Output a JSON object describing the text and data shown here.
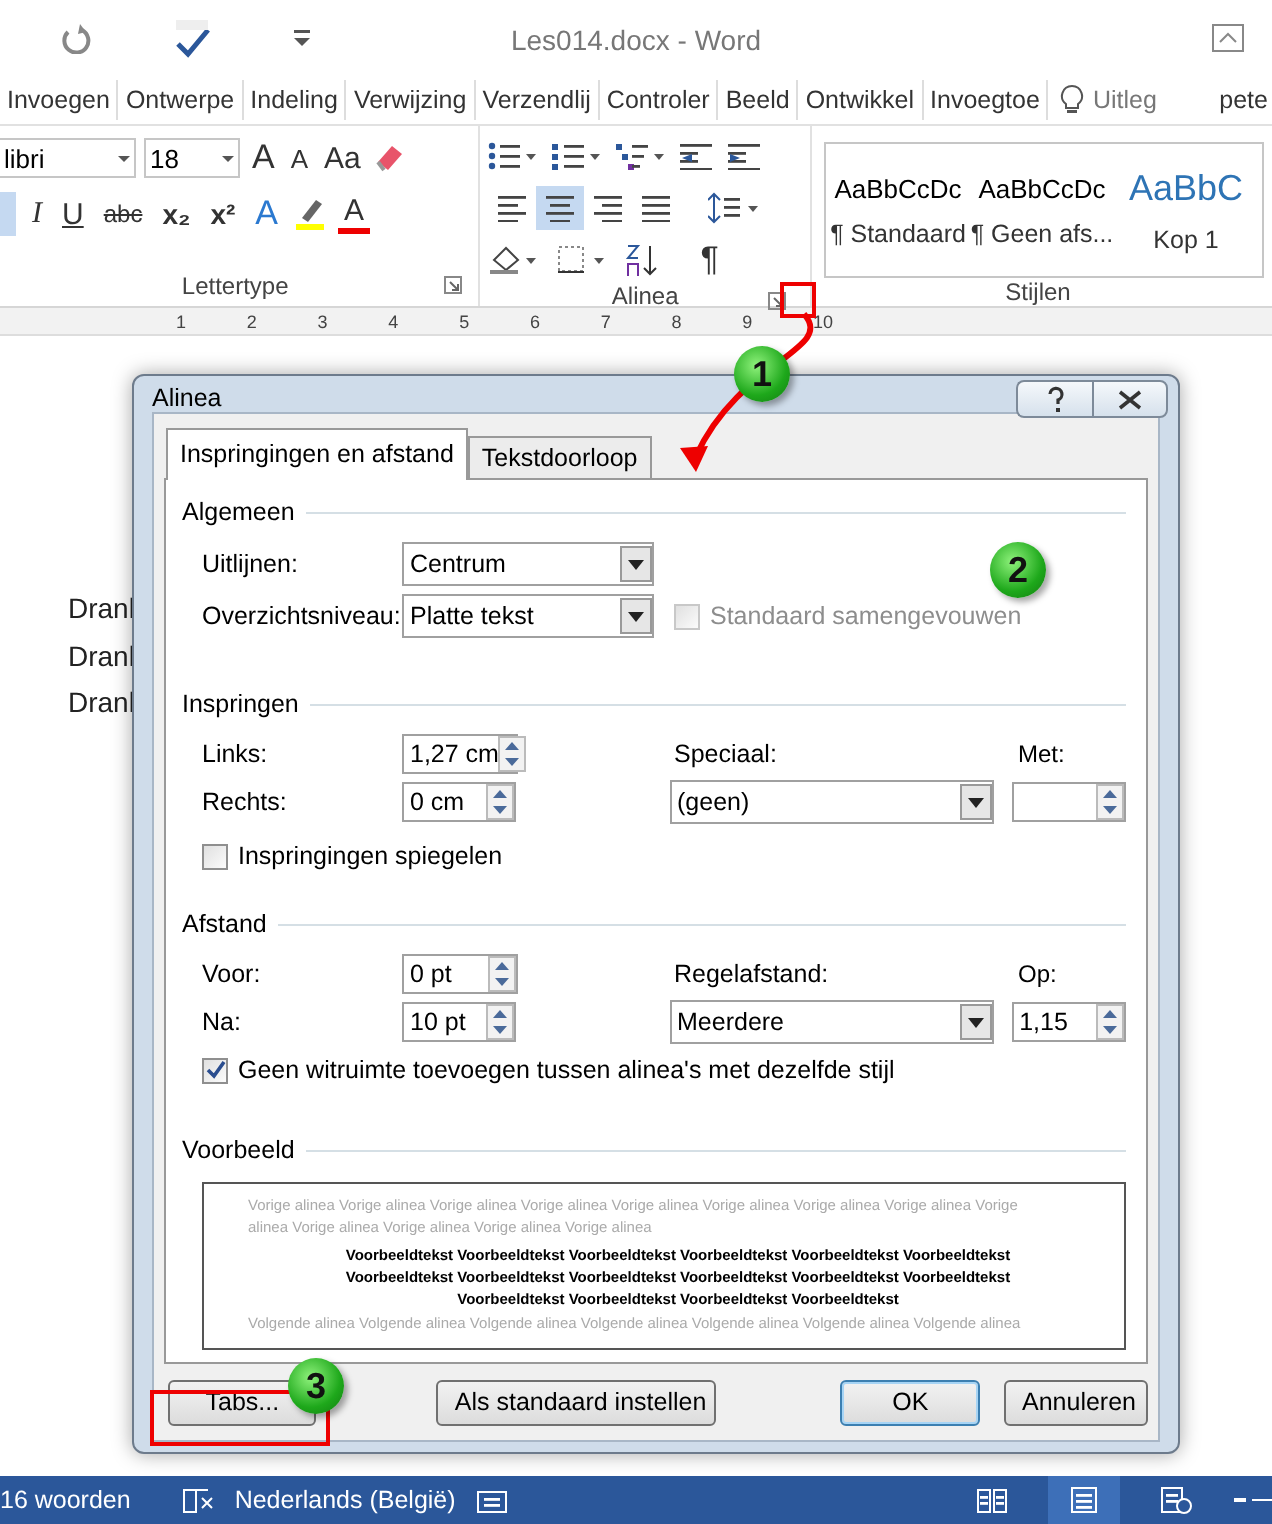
{
  "title_bar": {
    "title": "Les014.docx - Word"
  },
  "ribbon_tabs": [
    {
      "label": "Invoegen",
      "selected": false
    },
    {
      "label": "Ontwerpe",
      "selected": false
    },
    {
      "label": "Indeling",
      "selected": false
    },
    {
      "label": "Verwijzing",
      "selected": false
    },
    {
      "label": "Verzendlij",
      "selected": false
    },
    {
      "label": "Controler",
      "selected": false
    },
    {
      "label": "Beeld",
      "selected": false
    },
    {
      "label": "Ontwikkel",
      "selected": false
    },
    {
      "label": "Invoegtoe",
      "selected": false
    }
  ],
  "tell_me": "Uitleg",
  "user": "pete",
  "font_group": {
    "label": "Lettertype",
    "font": "libri",
    "size": "18",
    "grow": "A",
    "shrink": "A",
    "case": "Aa",
    "format_buttons": [
      "I",
      "U",
      "abc",
      "x₂",
      "x²"
    ],
    "effects": "A",
    "font_color_glyph": "A"
  },
  "paragraph_group": {
    "label": "Alinea",
    "align_buttons": [
      {
        "kind": "left",
        "selected": false
      },
      {
        "kind": "center",
        "selected": true
      },
      {
        "kind": "right",
        "selected": false
      },
      {
        "kind": "justify",
        "selected": false
      }
    ],
    "pilcrow": "¶"
  },
  "styles_group": {
    "label": "Stijlen",
    "items": [
      {
        "sample": "AaBbCcDc",
        "name": "¶ Standaard",
        "kind": "normal"
      },
      {
        "sample": "AaBbCcDc",
        "name": "¶ Geen afs...",
        "kind": "normal"
      },
      {
        "sample": "AaBbC",
        "name": "Kop 1",
        "kind": "heading"
      }
    ]
  },
  "ruler": [
    "1",
    "2",
    "3",
    "4",
    "5",
    "6",
    "7",
    "8",
    "9",
    "10"
  ],
  "document_lines": [
    "Dranl",
    "Dranl",
    "Dranl"
  ],
  "dialog": {
    "title": "Alinea",
    "tabs": [
      {
        "label": "Inspringingen en afstand",
        "selected": true
      },
      {
        "label": "Tekstdoorloop",
        "selected": false
      }
    ],
    "general": {
      "heading": "Algemeen",
      "alignment": {
        "label": "Uitlijnen:",
        "value": "Centrum"
      },
      "outline_level": {
        "label": "Overzichtsniveau:",
        "value": "Platte tekst"
      },
      "collapsed": {
        "label": "Standaard samengevouwen",
        "checked": false,
        "disabled": true
      }
    },
    "indentation": {
      "heading": "Inspringen",
      "left": {
        "label": "Links:",
        "value": "1,27 cm"
      },
      "right": {
        "label": "Rechts:",
        "value": "0 cm"
      },
      "special": {
        "label": "Speciaal:",
        "value": "(geen)"
      },
      "by": {
        "label": "Met:"
      },
      "mirror": {
        "label": "Inspringingen spiegelen",
        "checked": false,
        "disabled": false
      }
    },
    "spacing": {
      "heading": "Afstand",
      "before": {
        "label": "Voor:",
        "value": "0 pt"
      },
      "after": {
        "label": "Na:",
        "value": "10 pt"
      },
      "line_spacing": {
        "label": "Regelafstand:",
        "value": "Meerdere"
      },
      "at": {
        "label": "Op:",
        "value": "1,15"
      },
      "no_space": {
        "label": "Geen witruimte toevoegen tussen alinea's met dezelfde stijl",
        "checked": true,
        "disabled": false
      }
    },
    "preview": {
      "heading": "Voorbeeld",
      "previous": [
        "Vorige alinea Vorige alinea Vorige alinea Vorige alinea Vorige alinea Vorige alinea Vorige alinea Vorige alinea Vorige",
        "alinea Vorige alinea Vorige alinea Vorige alinea Vorige alinea"
      ],
      "sample": [
        "Voorbeeldtekst Voorbeeldtekst Voorbeeldtekst Voorbeeldtekst Voorbeeldtekst Voorbeeldtekst",
        "Voorbeeldtekst Voorbeeldtekst Voorbeeldtekst Voorbeeldtekst Voorbeeldtekst Voorbeeldtekst",
        "Voorbeeldtekst Voorbeeldtekst Voorbeeldtekst Voorbeeldtekst"
      ],
      "next": [
        "Volgende alinea Volgende alinea Volgende alinea Volgende alinea Volgende alinea Volgende alinea Volgende alinea"
      ]
    },
    "buttons": [
      {
        "label": "Tabs...",
        "default": false
      },
      {
        "label": "Als standaard instellen",
        "default": false
      },
      {
        "label": "OK",
        "default": true
      },
      {
        "label": "Annuleren",
        "default": false
      }
    ]
  },
  "annotations": {
    "badges": [
      "1",
      "2",
      "3"
    ]
  },
  "status_bar": {
    "words": "16 woorden",
    "language": "Nederlands (België)",
    "views": [
      {
        "kind": "read",
        "selected": false
      },
      {
        "kind": "print",
        "selected": true
      },
      {
        "kind": "web",
        "selected": false
      }
    ]
  }
}
